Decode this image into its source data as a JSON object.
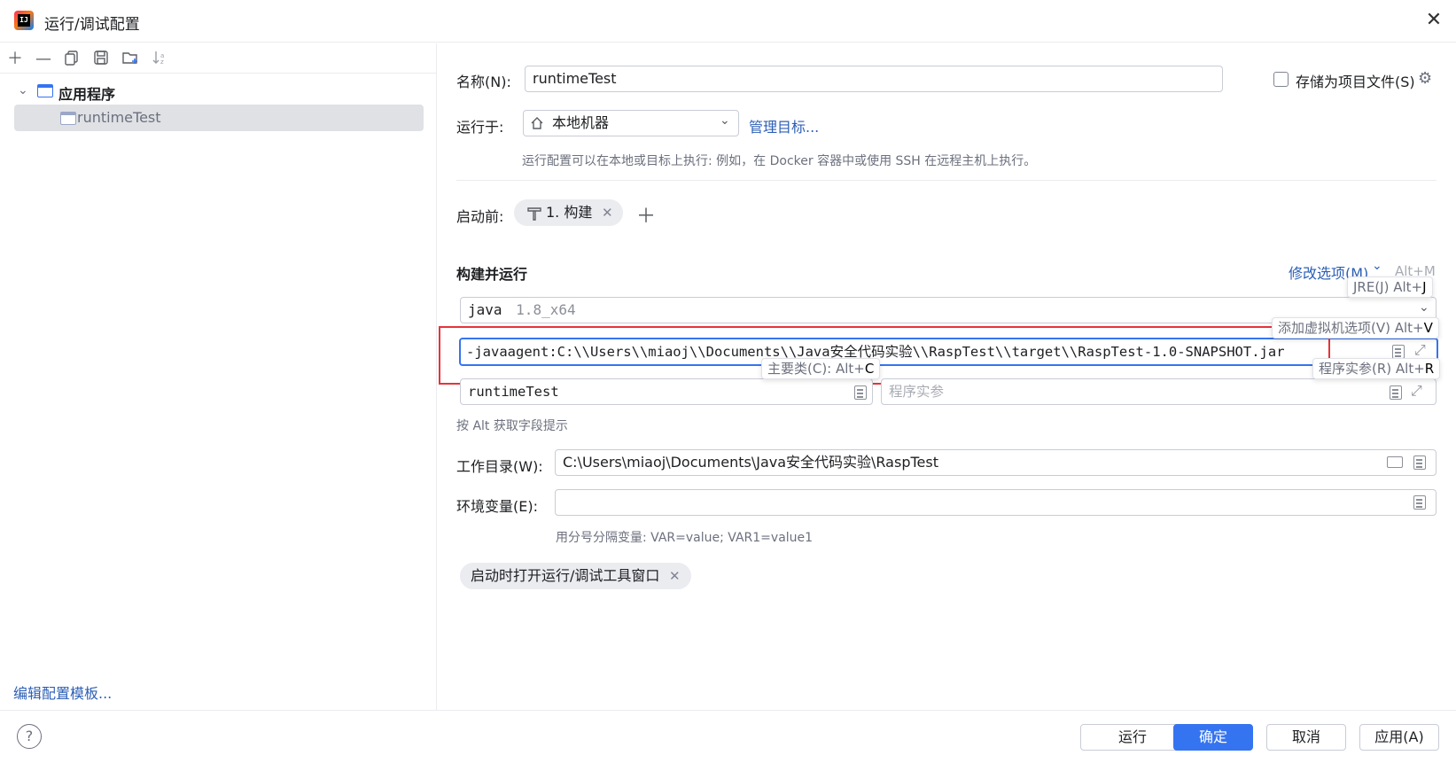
{
  "window": {
    "title": "运行/调试配置",
    "close_icon": "close-icon"
  },
  "sidebar": {
    "toolbar": [
      "add-icon",
      "remove-icon",
      "copy-icon",
      "save-icon",
      "new-folder-icon",
      "sort-icon"
    ],
    "group_label": "应用程序",
    "item_label": "runtimeTest",
    "edit_templates_link": "编辑配置模板..."
  },
  "form": {
    "name_label": "名称(N):",
    "name_value": "runtimeTest",
    "store_as_file_label": "存储为项目文件(S)",
    "run_on_label": "运行于:",
    "run_on_value": "本地机器",
    "manage_targets_link": "管理目标...",
    "run_on_hint": "运行配置可以在本地或目标上执行: 例如，在 Docker 容器中或使用 SSH 在远程主机上执行。",
    "before_launch_label": "启动前:",
    "before_launch_task": "1. 构建",
    "build_run_title": "构建并运行",
    "modify_options_link": "修改选项(M)",
    "modify_options_shortcut": "Alt+M",
    "jre_name": "java",
    "jre_version": "1.8_x64",
    "vm_options_value": "-javaagent:C:\\\\Users\\\\miaoj\\\\Documents\\\\Java安全代码实验\\\\RaspTest\\\\target\\\\RaspTest-1.0-SNAPSHOT.jar",
    "main_class_value": "runtimeTest",
    "program_args_placeholder": "程序实参",
    "alt_hint": "按 Alt 获取字段提示",
    "working_dir_label": "工作目录(W):",
    "working_dir_value": "C:\\Users\\miaoj\\Documents\\Java安全代码实验\\RaspTest",
    "env_label": "环境变量(E):",
    "env_value": "",
    "env_hint": "用分号分隔变量: VAR=value; VAR1=value1",
    "open_tool_window_chip": "启动时打开运行/调试工具窗口"
  },
  "tooltips": {
    "jre": {
      "text": "JRE(J) Alt+",
      "key": "J"
    },
    "vm": {
      "text": "添加虚拟机选项(V) Alt+",
      "key": "V"
    },
    "main_class": {
      "text": "主要类(C): Alt+",
      "key": "C"
    },
    "program_args": {
      "text": "程序实参(R) Alt+",
      "key": "R"
    }
  },
  "buttons": {
    "run": "运行",
    "ok": "确定",
    "cancel": "取消",
    "apply": "应用(A)"
  },
  "colors": {
    "accent": "#3574f0",
    "highlight_box": "#e5343a"
  }
}
